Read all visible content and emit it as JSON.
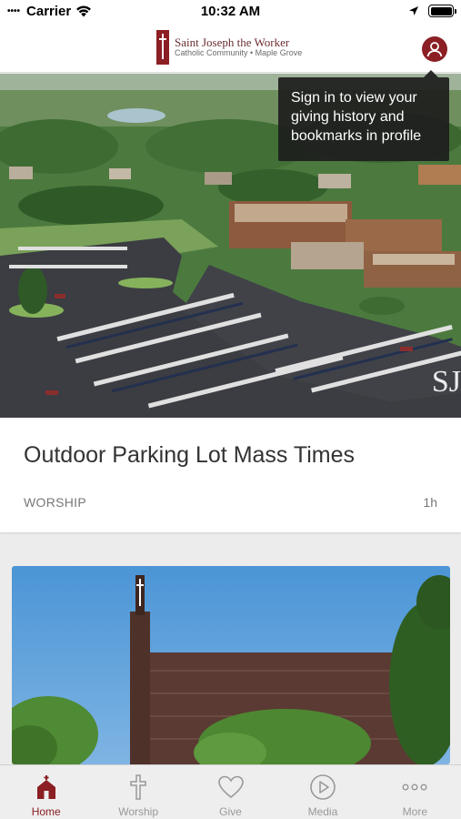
{
  "status_bar": {
    "carrier": "Carrier",
    "time": "10:32 AM"
  },
  "header": {
    "logo_line1": "Saint Joseph the Worker",
    "logo_line2": "Catholic Community • Maple Grove",
    "profile_icon": "person-icon"
  },
  "tooltip": {
    "text": "Sign in to view your giving history and bookmarks in profile"
  },
  "hero": {
    "watermark": "SJ"
  },
  "cards": [
    {
      "title": "Outdoor Parking Lot Mass Times",
      "category": "WORSHIP",
      "time": "1h"
    }
  ],
  "tabs": [
    {
      "label": "Home",
      "icon": "church-icon",
      "active": true
    },
    {
      "label": "Worship",
      "icon": "cross-icon",
      "active": false
    },
    {
      "label": "Give",
      "icon": "heart-icon",
      "active": false
    },
    {
      "label": "Media",
      "icon": "play-icon",
      "active": false
    },
    {
      "label": "More",
      "icon": "more-icon",
      "active": false
    }
  ],
  "colors": {
    "accent": "#8b1f24",
    "inactive_tab": "#999999"
  }
}
